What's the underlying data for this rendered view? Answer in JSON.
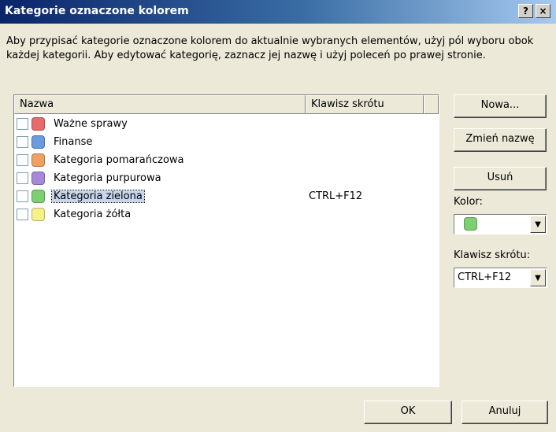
{
  "window": {
    "title": "Kategorie oznaczone kolorem",
    "help_label": "?",
    "close_label": "×"
  },
  "description": "Aby przypisać kategorie oznaczone kolorem do aktualnie wybranych elementów, użyj pól wyboru obok każdej kategorii. Aby edytować kategorię, zaznacz jej nazwę i użyj poleceń po prawej stronie.",
  "list": {
    "columns": [
      "Nazwa",
      "Klawisz skrótu"
    ],
    "items": [
      {
        "name": "Ważne sprawy",
        "color": "#e86a6a",
        "shortcut": "",
        "checked": false,
        "selected": false
      },
      {
        "name": "Finanse",
        "color": "#6b9ae0",
        "shortcut": "",
        "checked": false,
        "selected": false
      },
      {
        "name": "Kategoria pomarańczowa",
        "color": "#f0a060",
        "shortcut": "",
        "checked": false,
        "selected": false
      },
      {
        "name": "Kategoria purpurowa",
        "color": "#a888d8",
        "shortcut": "",
        "checked": false,
        "selected": false
      },
      {
        "name": "Kategoria zielona",
        "color": "#7ecf72",
        "shortcut": "CTRL+F12",
        "checked": false,
        "selected": true
      },
      {
        "name": "Kategoria żółta",
        "color": "#f5f08a",
        "shortcut": "",
        "checked": false,
        "selected": false
      }
    ]
  },
  "side": {
    "new_label": "Nowa...",
    "rename_label": "Zmień nazwę",
    "delete_label": "Usuń",
    "color_label": "Kolor:",
    "color_value": "#7ecf72",
    "shortcut_label": "Klawisz skrótu:",
    "shortcut_value": "CTRL+F12"
  },
  "footer": {
    "ok_label": "OK",
    "cancel_label": "Anuluj"
  }
}
